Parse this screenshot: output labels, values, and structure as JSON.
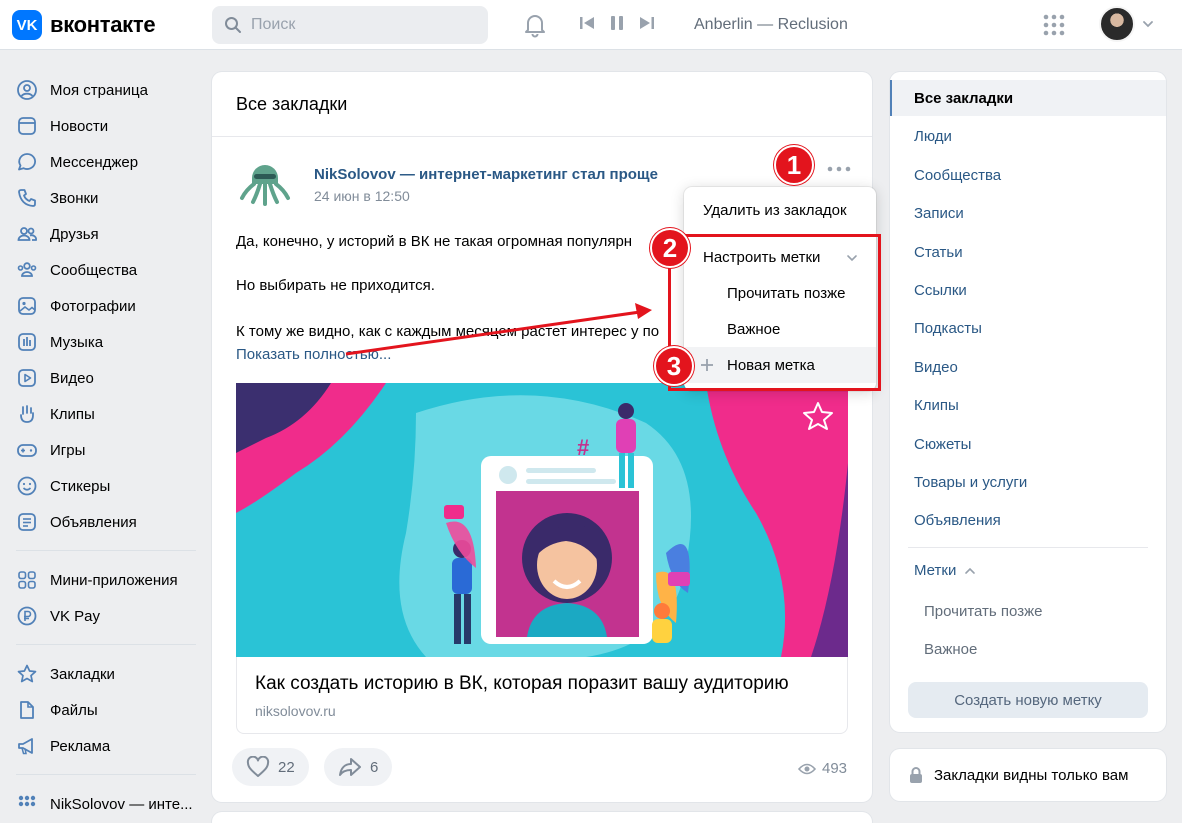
{
  "header": {
    "logo_text": "вконтакте",
    "logo_mark": "VK",
    "search_placeholder": "Поиск",
    "track": "Anberlin — Reclusion"
  },
  "sidebar": {
    "items": [
      {
        "label": "Моя страница",
        "icon": "user-circle-icon"
      },
      {
        "label": "Новости",
        "icon": "news-icon"
      },
      {
        "label": "Мессенджер",
        "icon": "message-icon"
      },
      {
        "label": "Звонки",
        "icon": "phone-icon"
      },
      {
        "label": "Друзья",
        "icon": "friends-icon"
      },
      {
        "label": "Сообщества",
        "icon": "communities-icon"
      },
      {
        "label": "Фотографии",
        "icon": "photo-icon"
      },
      {
        "label": "Музыка",
        "icon": "music-icon"
      },
      {
        "label": "Видео",
        "icon": "video-icon"
      },
      {
        "label": "Клипы",
        "icon": "clips-icon"
      },
      {
        "label": "Игры",
        "icon": "gamepad-icon"
      },
      {
        "label": "Стикеры",
        "icon": "smile-icon"
      },
      {
        "label": "Объявления",
        "icon": "ads-icon"
      }
    ],
    "items2": [
      {
        "label": "Мини-приложения",
        "icon": "apps-icon"
      },
      {
        "label": "VK Pay",
        "icon": "vkpay-icon"
      }
    ],
    "items3": [
      {
        "label": "Закладки",
        "icon": "star-icon"
      },
      {
        "label": "Файлы",
        "icon": "file-icon"
      },
      {
        "label": "Реклама",
        "icon": "megaphone-icon"
      }
    ],
    "items4": [
      {
        "label": "NikSolovov — инте...",
        "icon": "group-icon"
      }
    ]
  },
  "main": {
    "title": "Все закладки",
    "post": {
      "author": "NikSolovov — интернет-маркетинг стал проще",
      "date": "24 июн в 12:50",
      "lines": [
        "Да, конечно, у историй в ВК не такая огромная популярн",
        "Но выбирать не приходится.",
        "К тому же видно, как с каждым месяцем растет интерес у по"
      ],
      "show_more": "Показать полностью...",
      "link_title": "Как создать историю в ВК, которая поразит вашу аудиторию",
      "link_domain": "niksolovov.ru",
      "likes": "22",
      "shares": "6",
      "views": "493"
    }
  },
  "dropdown": {
    "remove": "Удалить из закладок",
    "configure": "Настроить метки",
    "tag1": "Прочитать позже",
    "tag2": "Важное",
    "new_tag": "Новая метка"
  },
  "badges": [
    "1",
    "2",
    "3"
  ],
  "right": {
    "items": [
      "Все закладки",
      "Люди",
      "Сообщества",
      "Записи",
      "Статьи",
      "Ссылки",
      "Подкасты",
      "Видео",
      "Клипы",
      "Сюжеты",
      "Товары и услуги",
      "Объявления"
    ],
    "tags_title": "Метки",
    "tags": [
      "Прочитать позже",
      "Важное"
    ],
    "create_button": "Создать новую метку",
    "privacy": "Закладки видны только вам"
  },
  "colors": {
    "accent": "#0077ff",
    "link": "#2a5885",
    "highlight_red": "#e3141d",
    "background": "#edeef0"
  }
}
